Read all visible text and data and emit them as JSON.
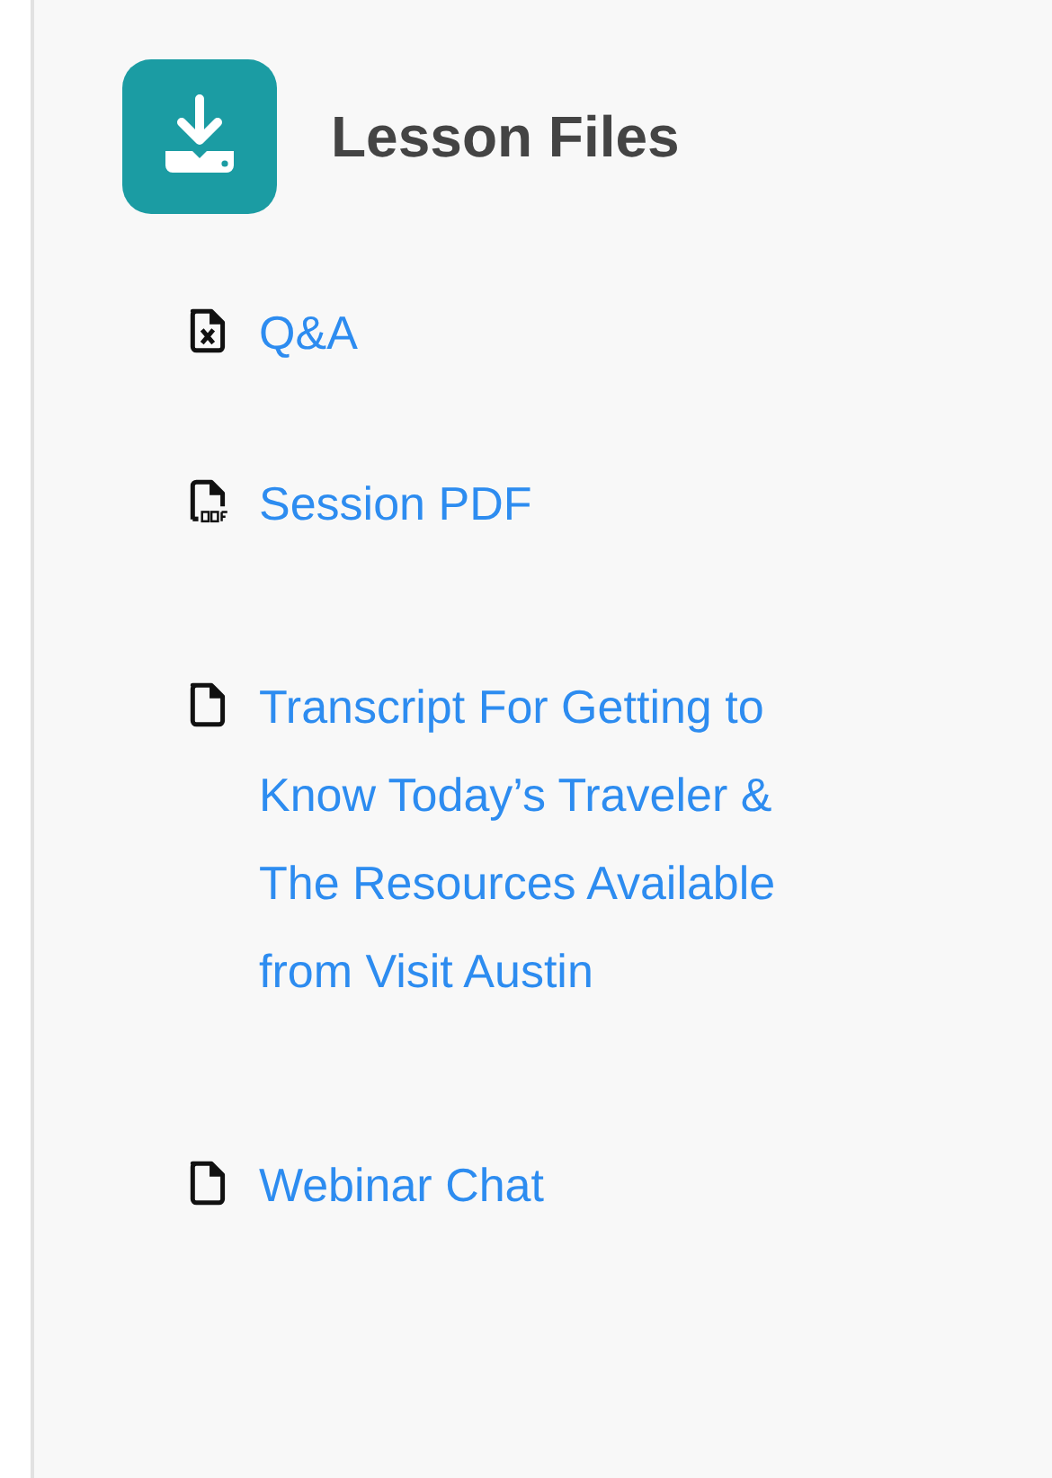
{
  "header": {
    "title": "Lesson Files"
  },
  "files": [
    {
      "kind": "spreadsheet",
      "label": "Q&A"
    },
    {
      "kind": "pdf",
      "label": "Session PDF"
    },
    {
      "kind": "document",
      "label": "Transcript For Getting to Know Today’s Traveler & The Resources Available from Visit Austin"
    },
    {
      "kind": "document",
      "label": "Webinar Chat"
    }
  ]
}
